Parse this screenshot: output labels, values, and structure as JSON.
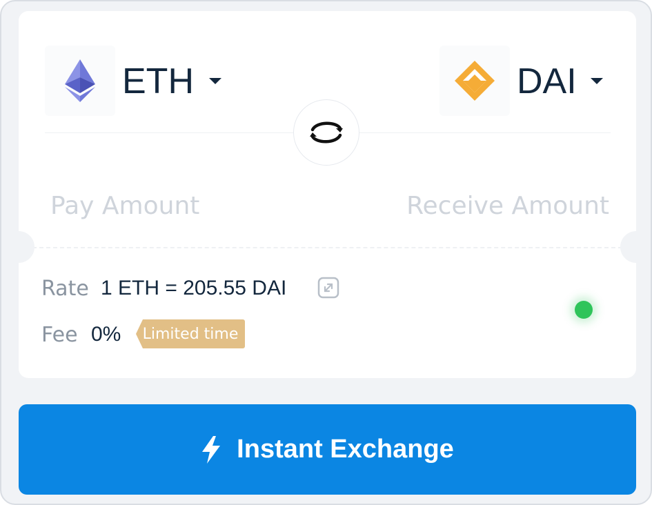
{
  "pair": {
    "from": {
      "symbol": "ETH",
      "icon": "eth-icon"
    },
    "to": {
      "symbol": "DAI",
      "icon": "dai-icon"
    },
    "swap_icon": "swap-arrows-icon"
  },
  "amounts": {
    "pay_placeholder": "Pay Amount",
    "receive_placeholder": "Receive Amount"
  },
  "rate": {
    "label": "Rate",
    "value": "1 ETH = 205.55 DAI",
    "expand_icon": "expand-icon"
  },
  "fee": {
    "label": "Fee",
    "value": "0%",
    "badge": "Limited time"
  },
  "status": {
    "color": "#2fc45a"
  },
  "action": {
    "label": "Instant Exchange",
    "icon": "lightning-icon",
    "color": "#0b86e3"
  }
}
